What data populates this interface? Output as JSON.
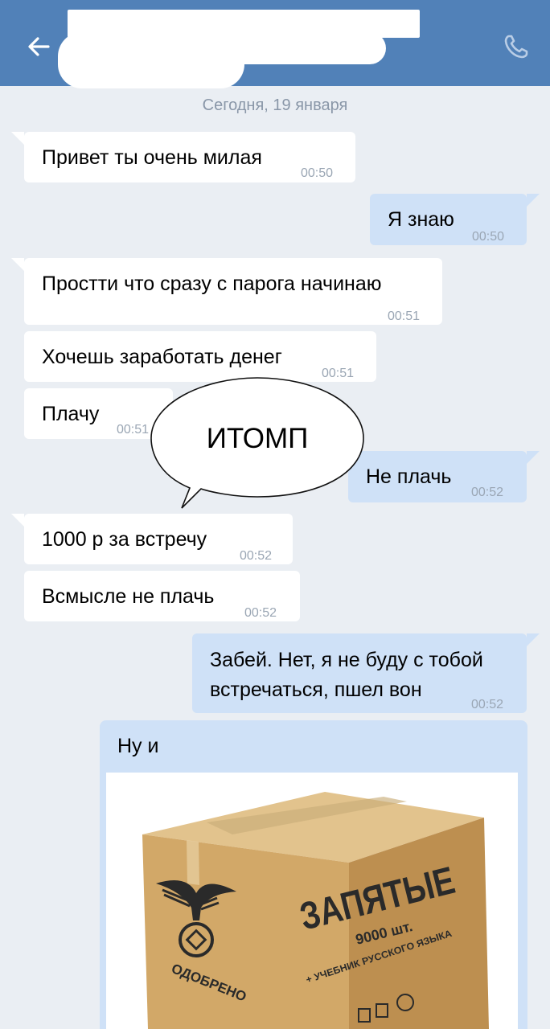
{
  "header": {
    "back_icon": "arrow-left-icon",
    "call_icon": "phone-icon",
    "bg_color": "#5181b8"
  },
  "date_divider": "Сегодня, 19 января",
  "messages": [
    {
      "side": "in",
      "text": "Привет ты очень милая",
      "time": "00:50"
    },
    {
      "side": "out",
      "text": "Я знаю",
      "time": "00:50"
    },
    {
      "side": "in",
      "text": "Простти что сразу с парога начинаю",
      "time": "00:51"
    },
    {
      "side": "in",
      "text": "Хочешь заработать денег",
      "time": "00:51"
    },
    {
      "side": "in",
      "text": "Плачу",
      "time": "00:51"
    },
    {
      "side": "out",
      "text": "Не плачь",
      "time": "00:52"
    },
    {
      "side": "in",
      "text": "1000 р за встречу",
      "time": "00:52"
    },
    {
      "side": "in",
      "text": "Всмысле не плачь",
      "time": "00:52"
    },
    {
      "side": "out",
      "text_line1": "Забей. Нет, я не буду с тобой",
      "text_line2": "встречаться, пшел вон",
      "time": "00:52"
    },
    {
      "side": "out",
      "text": "Ну и"
    }
  ],
  "speech_bubble": "ИТОМП",
  "box_image": {
    "line1": "ЗАПЯТЫЕ",
    "line2": "9000 шт.",
    "line3": "+ УЧЕБНИК РУССКОГО ЯЗЫКА",
    "stamp": "ОДОБРЕНО"
  }
}
